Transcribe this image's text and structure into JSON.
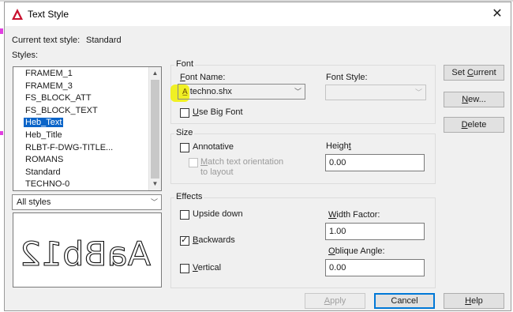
{
  "window": {
    "title": "Text Style"
  },
  "current_style": {
    "label": "Current text style:",
    "value": "Standard"
  },
  "styles": {
    "label": "Styles:",
    "items": [
      "FRAMEM_1",
      "FRAMEM_3",
      "FS_BLOCK_ATT",
      "FS_BLOCK_TEXT",
      "Heb_Text",
      "Heb_Title",
      "RLBT-F-DWG-TITLE...",
      "ROMANS",
      "Standard",
      "TECHNO-0"
    ],
    "selected": "Heb_Text"
  },
  "filter": {
    "value": "All styles"
  },
  "preview": {
    "text": "AaBb12"
  },
  "font": {
    "group": "Font",
    "name_label": "Font Name:",
    "name_value": "techno.shx",
    "style_label": "Font Style:",
    "style_value": "",
    "big_font_label": "Use Big Font",
    "big_font_checked": false
  },
  "size": {
    "group": "Size",
    "annotative_label": "Annotative",
    "annotative_checked": false,
    "match_label_1": "Match text orientation",
    "match_label_2": "to layout",
    "height_label": "Height",
    "height_value": "0.00"
  },
  "effects": {
    "group": "Effects",
    "upside_down_label": "Upside down",
    "upside_down_checked": false,
    "backwards_label": "Backwards",
    "backwards_checked": true,
    "vertical_label": "Vertical",
    "vertical_checked": false,
    "width_factor_label": "Width Factor:",
    "width_factor_value": "1.00",
    "oblique_label": "Oblique Angle:",
    "oblique_value": "0.00"
  },
  "buttons": {
    "set_current": "Set Current",
    "new": "New...",
    "delete": "Delete",
    "apply": "Apply",
    "cancel": "Cancel",
    "help": "Help"
  },
  "colors": {
    "selection": "#0a64c8",
    "highlight": "#f0f000",
    "app_icon": "#c8102e"
  },
  "icons": {
    "app": "autocad-icon",
    "font_type": "shx-font-icon",
    "close": "close-icon",
    "check": "checkmark-icon"
  }
}
